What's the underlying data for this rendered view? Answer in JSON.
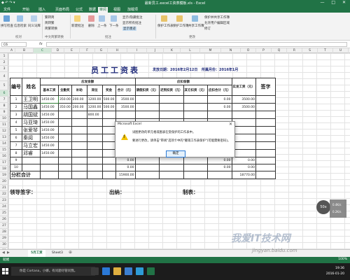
{
  "window": {
    "title": "最新员工.excel工资表模板.xls - Excel",
    "quick_access": "◆ ↶ ↷ ▾",
    "controls": "— □ ✕"
  },
  "ribbon_tabs": [
    "文件",
    "开始",
    "插入",
    "页面布局",
    "公式",
    "数据",
    "审阅",
    "视图",
    "加载项"
  ],
  "active_tab_index": 6,
  "ribbon": {
    "buttons": [
      "拼写检查",
      "信息检索",
      "同义词库",
      "繁转简",
      "简转繁",
      "简繁转换",
      "新建批注",
      "删除",
      "上一条",
      "下一条",
      "显示所有批注",
      "显示墨迹",
      "保护工作表",
      "保护工作簿",
      "共享工作簿"
    ],
    "small": [
      "显示/隐藏批注",
      "保护并共享工作簿",
      "允许用户编辑区域",
      "修订"
    ],
    "groups": [
      "校对",
      "中文简繁转换",
      "批注",
      "更改"
    ]
  },
  "formula_bar": {
    "name_box": "C6",
    "fx": "fx",
    "value": ""
  },
  "columns": [
    "A",
    "B",
    "C",
    "D",
    "E",
    "F",
    "G",
    "H",
    "I",
    "J",
    "K",
    "L",
    "M",
    "N",
    "O",
    "P",
    "Q",
    "R",
    "S",
    "T",
    "U"
  ],
  "selected_column": "C",
  "rows": [
    "1",
    "2",
    "3",
    "4",
    "5",
    "6",
    "7",
    "8",
    "9",
    "10",
    "11",
    "12",
    "13",
    "14",
    "15",
    "16",
    "17",
    "18",
    "19",
    "20",
    "21",
    "22",
    "23",
    "24",
    "25",
    "26",
    "27",
    "28",
    "29",
    "30",
    "31"
  ],
  "selected_row": "6",
  "sheet": {
    "title": "员工工资表",
    "date_label": "发放日期：2016年2月12日",
    "month_label": "所属月份：2016年1月",
    "headers": {
      "no": "编号",
      "name": "姓名",
      "payable": "应发金额",
      "deduct": "应扣金额",
      "sign": "签字",
      "cols": [
        "基本工资",
        "全勤奖",
        "补助",
        "岗位",
        "奖金",
        "合计（元）",
        "请假扣资（元）",
        "迟到扣资（元）",
        "其它扣资（元）",
        "应扣合计（元）",
        "实发工资（元）"
      ]
    },
    "rows": [
      {
        "no": "1",
        "name": "王卫明",
        "v": [
          "1450.00",
          "350.00",
          "200.00",
          "1200.00",
          "500.00",
          "3500.00",
          "",
          "",
          "",
          "0.00",
          "3500.00"
        ]
      },
      {
        "no": "2",
        "name": "马国鑫",
        "v": [
          "1450.00",
          "350.00",
          "200.00",
          "1200.00",
          "500.00",
          "3500.00",
          "",
          "",
          "",
          "0.00",
          "3500.00"
        ]
      },
      {
        "no": "3",
        "name": "胡国斌",
        "v": [
          "1450.00",
          "",
          "",
          "800.00",
          "",
          "",
          "",
          "",
          "",
          "",
          ""
        ]
      },
      {
        "no": "4",
        "name": "马亚琦",
        "v": [
          "1450.00",
          "",
          "",
          "",
          "",
          "",
          "",
          "",
          "",
          "",
          ""
        ]
      },
      {
        "no": "5",
        "name": "张爱琴",
        "v": [
          "1450.00",
          "",
          "",
          "",
          "",
          "",
          "",
          "",
          "",
          "",
          ""
        ]
      },
      {
        "no": "6",
        "name": "秦阅",
        "v": [
          "1450.00",
          "",
          "",
          "",
          "",
          "",
          "",
          "",
          "",
          "",
          ""
        ]
      },
      {
        "no": "7",
        "name": "马立宏",
        "v": [
          "1450.00",
          "",
          "",
          "",
          "",
          "",
          "",
          "",
          "",
          "",
          ""
        ]
      },
      {
        "no": "8",
        "name": "邓睿",
        "v": [
          "1450.00",
          "",
          "",
          "",
          "",
          "",
          "",
          "",
          "",
          "",
          ""
        ]
      },
      {
        "no": "9",
        "name": "",
        "v": [
          "",
          "",
          "",
          "",
          "",
          "0.00",
          "",
          "",
          "",
          "0.00",
          "0.00"
        ]
      },
      {
        "no": "10",
        "name": "",
        "v": [
          "",
          "",
          "",
          "",
          "",
          "0.00",
          "",
          "",
          "",
          "0.00",
          "0.00"
        ]
      }
    ],
    "total_label": "分栏合计",
    "total_values": [
      "15900.00",
      "",
      "",
      "",
      "18770.00"
    ],
    "signs": {
      "leader": "领导签字：",
      "cashier": "出纳：",
      "tabler": "制表："
    }
  },
  "dialog": {
    "title": "Microsoft Excel",
    "close": "✕",
    "line1": "试图更改的单元格或图表在受保护的工作表中。",
    "line2": "要进行更改，请单击\"审阅\"选项卡中的\"撤销工作表保护\"(可能需要密码)。",
    "ok": "确定"
  },
  "zoom_overlay": {
    "value": "50x",
    "lines": [
      "0.4K/s",
      "0.2K/s"
    ]
  },
  "sheet_tabs": [
    "5月工资",
    "Sheet3"
  ],
  "active_sheet": 0,
  "add_sheet": "⊕",
  "status": {
    "ready": "就绪",
    "zoom": "100%"
  },
  "taskbar": {
    "search": "你是 Cortana，小娜。有问题尽管问我。",
    "time": "19:36",
    "date": "2016-01-20"
  },
  "watermark": {
    "main": "我爱IT技术网",
    "url": "jingyan.baidu.com"
  },
  "colors": {
    "excel_green": "#217346",
    "title_blue": "#1f2a7a",
    "warning_yellow": "#f2c200"
  }
}
